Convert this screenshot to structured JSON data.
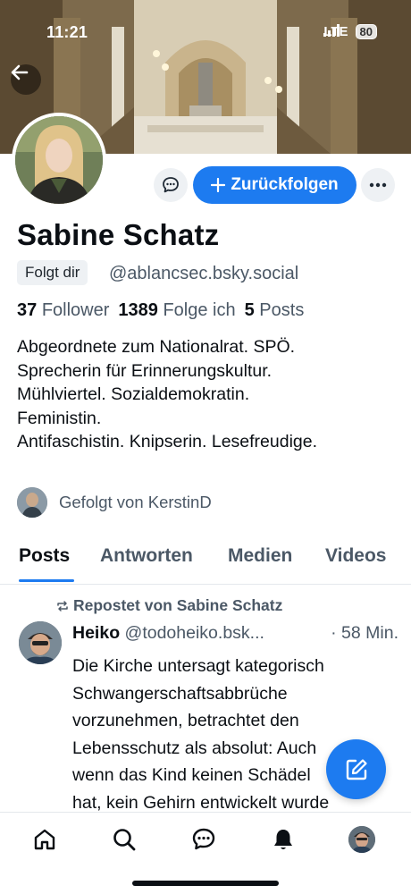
{
  "status_bar": {
    "time": "11:21",
    "network": "LTE",
    "battery": "80"
  },
  "profile": {
    "display_name": "Sabine Schatz",
    "follows_you_label": "Folgt dir",
    "handle": "@ablancsec.bsky.social",
    "followers_count": "37",
    "followers_label": "Follower",
    "following_count": "1389",
    "following_label": "Folge ich",
    "posts_count": "5",
    "posts_label": "Posts",
    "bio_lines": [
      "Abgeordnete zum Nationalrat. SPÖ.",
      "Sprecherin für Erinnerungskultur.",
      "Mühlviertel. Sozialdemokratin.",
      "Feministin.",
      "Antifaschistin. Knipserin. Lesefreudige."
    ],
    "followed_by_label": "Gefolgt von KerstinD"
  },
  "actions": {
    "follow_back_label": "Zurückfolgen"
  },
  "tabs": [
    {
      "label": "Posts",
      "active": true
    },
    {
      "label": "Antworten",
      "active": false
    },
    {
      "label": "Medien",
      "active": false
    },
    {
      "label": "Videos",
      "active": false
    }
  ],
  "feed": [
    {
      "repost_label": "Repostet von Sabine Schatz",
      "author": "Heiko",
      "handle": "@todoheiko.bsk...",
      "time": "· 58 Min.",
      "text_lines": [
        "Die Kirche untersagt kategorisch",
        "Schwangerschaftsabbrüche",
        "vorzunehmen, betrachtet den",
        "Lebensschutz als absolut: Auch",
        "wenn das Kind keinen Schädel",
        "hat, kein Gehirn entwickelt wurde"
      ]
    }
  ],
  "icons": {
    "back": "arrow-left-icon",
    "message": "chat-bubble-icon",
    "more": "ellipsis-icon",
    "repost": "repost-icon",
    "compose": "compose-icon",
    "nav": [
      "home-icon",
      "search-icon",
      "chat-icon",
      "bell-icon",
      "profile-avatar"
    ]
  },
  "colors": {
    "accent": "#1d7bf0",
    "text": "#0b0f14",
    "muted": "#4b5866"
  }
}
